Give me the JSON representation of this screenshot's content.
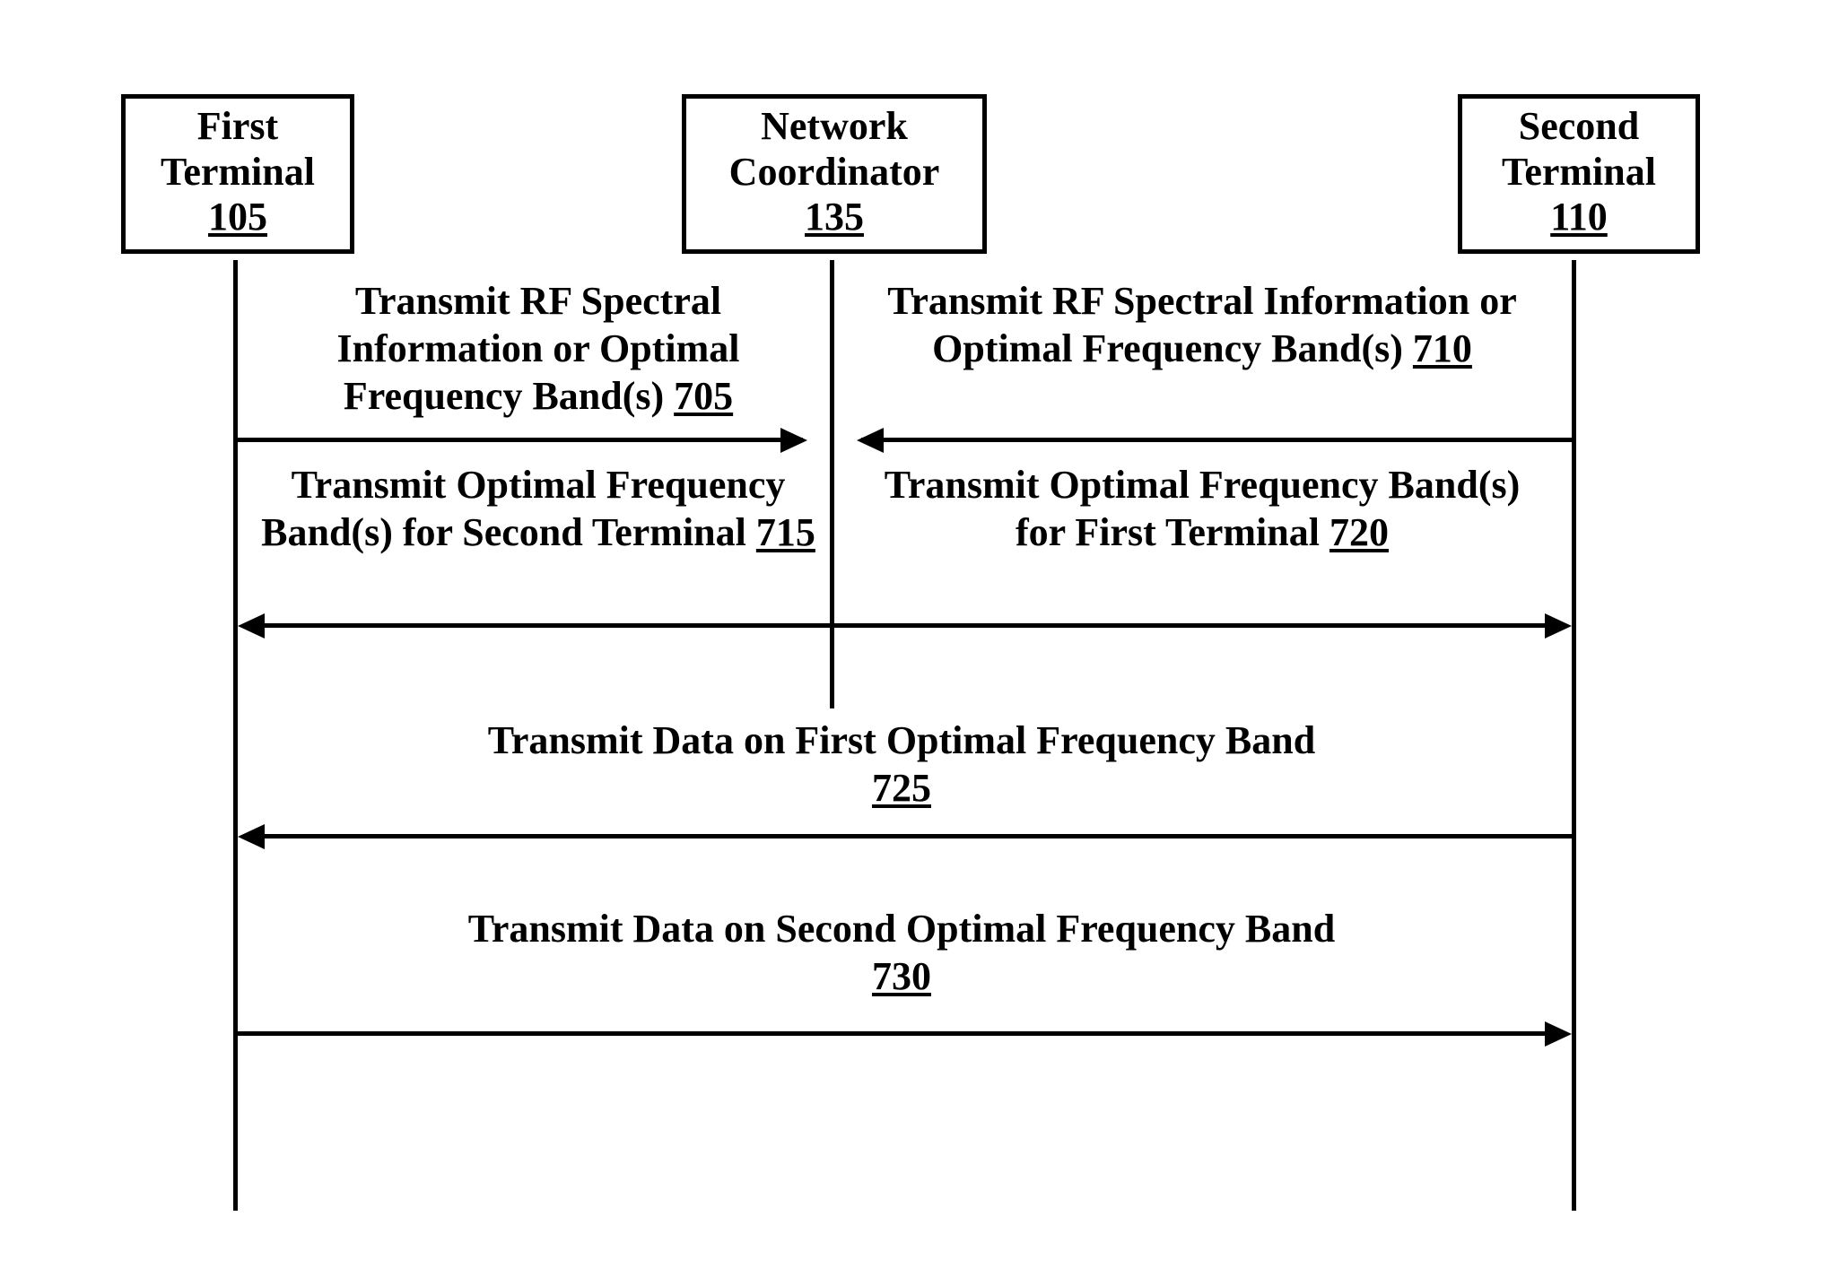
{
  "boxes": {
    "first": {
      "line1": "First",
      "line2": "Terminal",
      "num": "105"
    },
    "network": {
      "line1": "Network",
      "line2": "Coordinator",
      "num": "135"
    },
    "second": {
      "line1": "Second",
      "line2": "Terminal",
      "num": "110"
    }
  },
  "messages": {
    "m705": {
      "text": "Transmit RF Spectral Information or Optimal Frequency Band(s) ",
      "num": "705"
    },
    "m710": {
      "text": "Transmit RF Spectral Information or Optimal Frequency Band(s) ",
      "num": "710"
    },
    "m715": {
      "text": "Transmit Optimal Frequency Band(s) for Second Terminal ",
      "num": "715"
    },
    "m720": {
      "text": "Transmit Optimal Frequency Band(s) for First Terminal ",
      "num": "720"
    },
    "m725": {
      "text": "Transmit Data on First Optimal Frequency Band",
      "num": "725"
    },
    "m730": {
      "text": "Transmit Data on Second Optimal Frequency Band",
      "num": "730"
    }
  }
}
